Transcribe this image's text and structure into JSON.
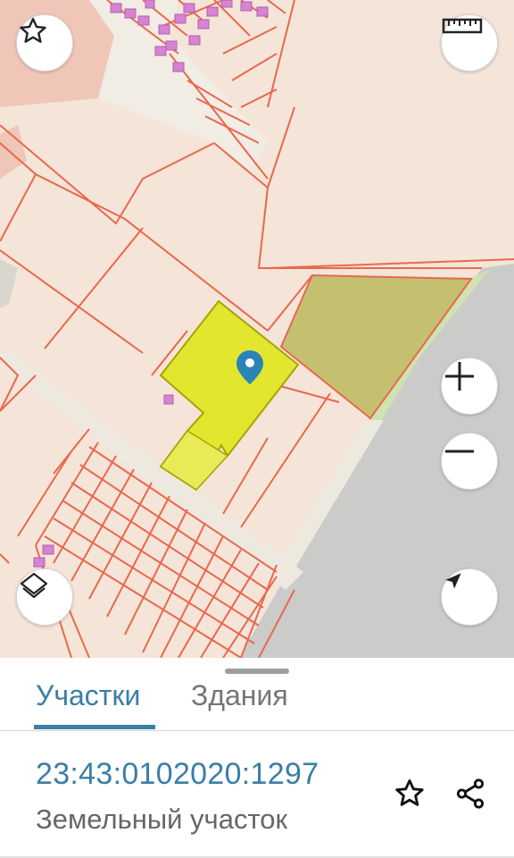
{
  "map": {
    "icons": {
      "favorite": "star-outline-icon",
      "ruler": "ruler-icon",
      "zoom_in": "plus-icon",
      "zoom_out": "minus-icon",
      "layers": "layers-icon",
      "locate": "navigation-arrow-icon",
      "marker": "map-pin-icon"
    },
    "colors": {
      "background": "#f5e4d8",
      "parcel_border": "#e8684e",
      "selected_parcel": "#e3e62f",
      "highlight_parcel": "#c4c070",
      "road": "#ece8dc",
      "water": "#cbcbc9",
      "building": "#d783d3",
      "marker": "#2a84b8"
    }
  },
  "sheet": {
    "tabs": [
      {
        "label": "Участки",
        "active": true
      },
      {
        "label": "Здания",
        "active": false
      }
    ],
    "parcel": {
      "cadastral_number": "23:43:0102020:1297",
      "type": "Земельный участок"
    },
    "actions": {
      "favorite_icon": "star-outline-icon",
      "share_icon": "share-icon"
    },
    "accent_color": "#3b7ea6"
  }
}
